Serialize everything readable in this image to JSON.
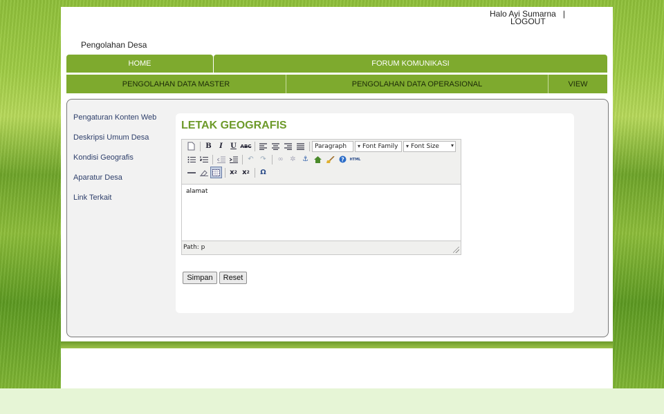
{
  "header": {
    "greeting": "Halo Ayi Sumarna",
    "separator": "|",
    "logout": "LOGOUT",
    "site_title": "Pengolahan Desa"
  },
  "nav_primary": [
    {
      "label": "HOME"
    },
    {
      "label": "FORUM KOMUNIKASI"
    }
  ],
  "nav_secondary": [
    {
      "label": "PENGOLAHAN DATA MASTER"
    },
    {
      "label": "PENGOLAHAN DATA OPERASIONAL"
    },
    {
      "label": "VIEW"
    }
  ],
  "sidebar": {
    "items": [
      {
        "label": "Pengaturan Konten Web"
      },
      {
        "label": "Deskripsi Umum Desa"
      },
      {
        "label": "Kondisi Geografis"
      },
      {
        "label": "Aparatur Desa"
      },
      {
        "label": "Link Terkait"
      }
    ]
  },
  "main": {
    "title": "LETAK GEOGRAFIS",
    "editor": {
      "format_select": "Paragraph",
      "font_family_select": "Font Family",
      "font_size_select": "Font Size",
      "content": "alamat",
      "path": "Path: p"
    },
    "buttons": {
      "save": "Simpan",
      "reset": "Reset"
    }
  },
  "colors": {
    "nav_green": "#7eaa2e",
    "title_green": "#6d9a2a"
  }
}
